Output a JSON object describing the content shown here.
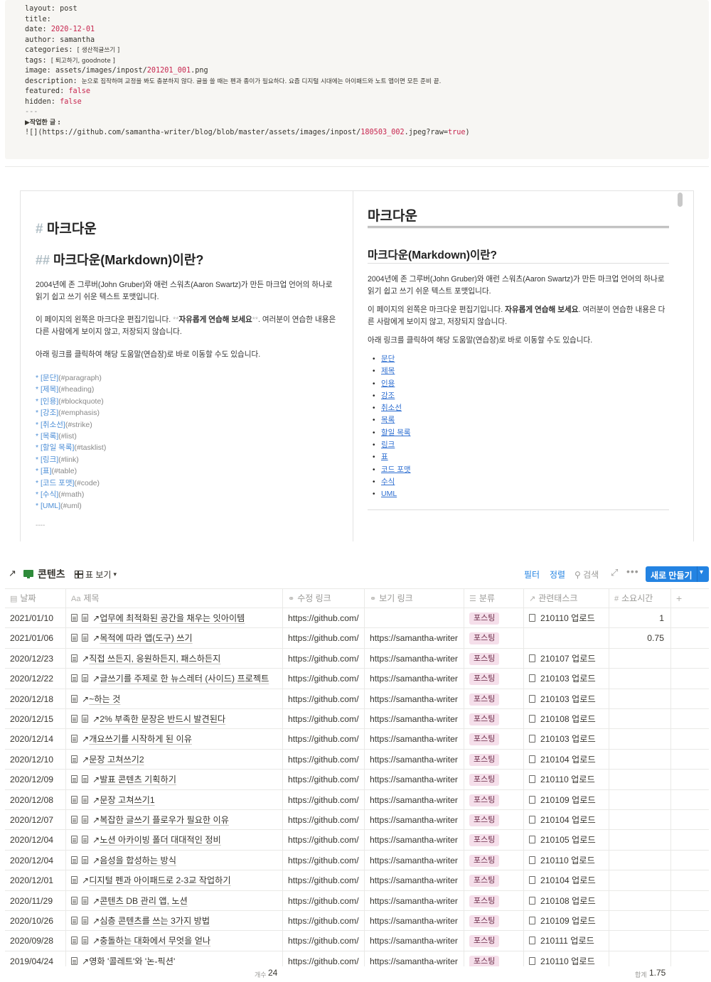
{
  "front_matter": {
    "layout_key": "layout:",
    "layout_val": "post",
    "title_key": "title:",
    "date_key": "date:",
    "date_val": "2020-12-01",
    "author_key": "author:",
    "author_val": "samantha",
    "categories_key": "categories:",
    "categories_val": "[ 생산적글쓰기 ]",
    "tags_key": "tags:",
    "tags_val": "[ 퇴고하기, goodnote ]",
    "image_key": "image:",
    "image_pre": "assets/images/inpost/",
    "image_num": "201201_001",
    "image_ext": ".png",
    "description_key": "description:",
    "description_val": "눈으로 짐작하며 교정을 봐도 충분하지 않다. 글을 쓸 때는 펜과 종이가 필요하다. 요즘 디지털 시대에는 아이패드와 노트 앱이면 모든 준비 끝.",
    "featured_key": "featured:",
    "featured_val": "false",
    "hidden_key": "hidden:",
    "hidden_val": "false",
    "end_marker": "---",
    "author_label": "▶작업한 글 :",
    "img_pre": "![](https://github.com/samantha-writer/blog/blob/master/assets/images/inpost/",
    "img_num": "180503_002",
    "img_mid": ".jpeg?raw=",
    "img_true": "true",
    "img_close": ")"
  },
  "editor": {
    "h1_hash": "#",
    "h1_text": "마크다운",
    "h2_hash": "##",
    "h2_text": "마크다운(Markdown)이란?",
    "p1": "2004년에 존 그루버(John Gruber)와 애런 스워츠(Aaron Swartz)가 만든 마크업 언어의 하나로 읽기 쉽고 쓰기 쉬운 텍스트 포맷입니다.",
    "p2_a": "이 페이지의 왼쪽은 마크다운 편집기입니다. ",
    "p2_mark_open": "**",
    "p2_bold": "자유롭게 연습해 보세요",
    "p2_mark_close": "**",
    "p2_b": ". 여러분이 연습한 내용은 다른 사람에게 보이지 않고, 저장되지 않습니다.",
    "p3": "아래 링크를 클릭하여 해당 도움말(연습장)로 바로 이동할 수도 있습니다.",
    "links": [
      {
        "text": "* [문단]",
        "anchor": "(#paragraph)"
      },
      {
        "text": "* [제목]",
        "anchor": "(#heading)"
      },
      {
        "text": "* [인용]",
        "anchor": "(#blockquote)"
      },
      {
        "text": "* [강조]",
        "anchor": "(#emphasis)"
      },
      {
        "text": "* [취소선]",
        "anchor": "(#strike)"
      },
      {
        "text": "* [목록]",
        "anchor": "(#list)"
      },
      {
        "text": "* [할일 목록]",
        "anchor": "(#tasklist)"
      },
      {
        "text": "* [링크]",
        "anchor": "(#link)"
      },
      {
        "text": "* [표]",
        "anchor": "(#table)"
      },
      {
        "text": "* [코드 포맷]",
        "anchor": "(#code)"
      },
      {
        "text": "* [수식]",
        "anchor": "(#math)"
      },
      {
        "text": "* [UML]",
        "anchor": "(#uml)"
      }
    ],
    "hr": "----"
  },
  "preview": {
    "h1": "마크다운",
    "h2": "마크다운(Markdown)이란?",
    "p1": "2004년에 존 그루버(John Gruber)와 애런 스워츠(Aaron Swartz)가 만든 마크업 언어의 하나로 읽기 쉽고 쓰기 쉬운 텍스트 포맷입니다.",
    "p2_a": "이 페이지의 왼쪽은 마크다운 편집기입니다. ",
    "p2_bold": "자유롭게 연습해 보세요",
    "p2_b": ". 여러분이 연습한 내용은 다른 사람에게 보이지 않고, 저장되지 않습니다.",
    "p3": "아래 링크를 클릭하여 해당 도움말(연습장)로 바로 이동할 수도 있습니다.",
    "links": [
      "문단",
      "제목",
      "인용",
      "강조",
      "취소선",
      "목록",
      "할일 목록",
      "링크",
      "표",
      "코드 포맷",
      "수식",
      "UML"
    ]
  },
  "database": {
    "title": "콘텐츠",
    "view_label": "표 보기",
    "filter": "필터",
    "sort": "정렬",
    "search": "검색",
    "new_button": "새로 만들기",
    "columns": {
      "date": "날짜",
      "title": "제목",
      "edit_link": "수정 링크",
      "view_link": "보기 링크",
      "category": "분류",
      "task": "관련태스크",
      "time": "소요시간",
      "add": "+"
    },
    "rows": [
      {
        "date": "2021/01/10",
        "title": "업무에 최적화된 공간을 채우는 잇아이템",
        "edit": "https://github.com/",
        "view": "",
        "cat": "포스팅",
        "task": "210110 업로드",
        "time": "1",
        "dbl": true
      },
      {
        "date": "2021/01/06",
        "title": "목적에 따라 앱(도구) 쓰기",
        "edit": "https://github.com/",
        "view": "https://samantha-writer",
        "cat": "포스팅",
        "task": "",
        "time": "0.75",
        "dbl": true
      },
      {
        "date": "2020/12/23",
        "title": "직접 쓰든지, 응원하든지, 패스하든지",
        "edit": "https://github.com/",
        "view": "https://samantha-writer",
        "cat": "포스팅",
        "task": "210107 업로드",
        "time": "",
        "dbl": false
      },
      {
        "date": "2020/12/22",
        "title": "글쓰기를 주제로 한 뉴스레터 (사이드) 프로젝트",
        "edit": "https://github.com/",
        "view": "https://samantha-writer",
        "cat": "포스팅",
        "task": "210103 업로드",
        "time": "",
        "dbl": true
      },
      {
        "date": "2020/12/18",
        "title": "~하는 것",
        "edit": "https://github.com/",
        "view": "https://samantha-writer",
        "cat": "포스팅",
        "task": "210103 업로드",
        "time": "",
        "dbl": false
      },
      {
        "date": "2020/12/15",
        "title": "2% 부족한 문장은 반드시 발견된다",
        "edit": "https://github.com/",
        "view": "https://samantha-writer",
        "cat": "포스팅",
        "task": "210108 업로드",
        "time": "",
        "dbl": true
      },
      {
        "date": "2020/12/14",
        "title": "개요쓰기를 시작하게 된 이유",
        "edit": "https://github.com/",
        "view": "https://samantha-writer",
        "cat": "포스팅",
        "task": "210103 업로드",
        "time": "",
        "dbl": false
      },
      {
        "date": "2020/12/10",
        "title": "문장 고쳐쓰기2",
        "edit": "https://github.com/",
        "view": "https://samantha-writer",
        "cat": "포스팅",
        "task": "210104 업로드",
        "time": "",
        "dbl": false
      },
      {
        "date": "2020/12/09",
        "title": "발표 콘텐츠 기획하기",
        "edit": "https://github.com/",
        "view": "https://samantha-writer",
        "cat": "포스팅",
        "task": "210110 업로드",
        "time": "",
        "dbl": true
      },
      {
        "date": "2020/12/08",
        "title": "문장 고쳐쓰기1",
        "edit": "https://github.com/",
        "view": "https://samantha-writer",
        "cat": "포스팅",
        "task": "210109 업로드",
        "time": "",
        "dbl": true
      },
      {
        "date": "2020/12/07",
        "title": "복잡한 글쓰기 플로우가 필요한 이유",
        "edit": "https://github.com/",
        "view": "https://samantha-writer",
        "cat": "포스팅",
        "task": "210104 업로드",
        "time": "",
        "dbl": true
      },
      {
        "date": "2020/12/04",
        "title": "노션 아카이빙 폴더 대대적인 정비",
        "edit": "https://github.com/",
        "view": "https://samantha-writer",
        "cat": "포스팅",
        "task": "210105 업로드",
        "time": "",
        "dbl": true
      },
      {
        "date": "2020/12/04",
        "title": "음성을 합성하는 방식",
        "edit": "https://github.com/",
        "view": "https://samantha-writer",
        "cat": "포스팅",
        "task": "210110 업로드",
        "time": "",
        "dbl": true
      },
      {
        "date": "2020/12/01",
        "title": "디지털 펜과 아이패드로 2-3교 작업하기",
        "edit": "https://github.com/",
        "view": "https://samantha-writer",
        "cat": "포스팅",
        "task": "210104 업로드",
        "time": "",
        "dbl": false
      },
      {
        "date": "2020/11/29",
        "title": "콘텐츠 DB 관리 앱, 노션",
        "edit": "https://github.com/",
        "view": "https://samantha-writer",
        "cat": "포스팅",
        "task": "210108 업로드",
        "time": "",
        "dbl": true
      },
      {
        "date": "2020/10/26",
        "title": "심층 콘텐츠를 쓰는 3가지 방법",
        "edit": "https://github.com/",
        "view": "https://samantha-writer",
        "cat": "포스팅",
        "task": "210109 업로드",
        "time": "",
        "dbl": true
      },
      {
        "date": "2020/09/28",
        "title": "충돌하는 대화에서 무엇을 얻나",
        "edit": "https://github.com/",
        "view": "https://samantha-writer",
        "cat": "포스팅",
        "task": "210111 업로드",
        "time": "",
        "dbl": true
      },
      {
        "date": "2019/04/24",
        "title": "영화 '콜레트'와 '논-픽션'",
        "edit": "https://github.com/",
        "view": "https://samantha-writer",
        "cat": "포스팅",
        "task": "210110 업로드",
        "time": "",
        "dbl": false
      }
    ],
    "footer": {
      "count_label": "개수",
      "count": "24",
      "sum_label": "합계",
      "sum": "1.75"
    }
  }
}
